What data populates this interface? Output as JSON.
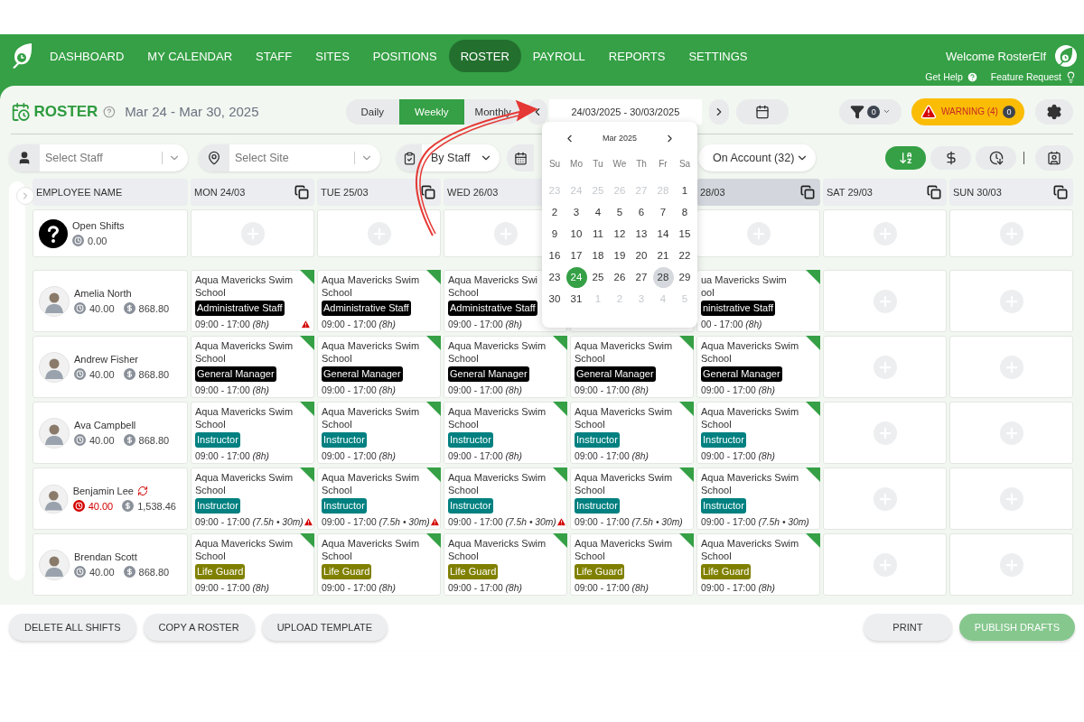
{
  "nav": {
    "items": [
      {
        "label": "DASHBOARD",
        "selected": false
      },
      {
        "label": "MY CALENDAR",
        "selected": false
      },
      {
        "label": "STAFF",
        "selected": false
      },
      {
        "label": "SITES",
        "selected": false
      },
      {
        "label": "POSITIONS",
        "selected": false
      },
      {
        "label": "ROSTER",
        "selected": true
      },
      {
        "label": "PAYROLL",
        "selected": false
      },
      {
        "label": "REPORTS",
        "selected": false
      },
      {
        "label": "SETTINGS",
        "selected": false
      }
    ],
    "welcome": "Welcome RosterElf",
    "links": [
      "Get Help",
      "Feature Request"
    ]
  },
  "header": {
    "title": "ROSTER",
    "date_range": "Mar 24 - Mar 30, 2025",
    "view_tabs": [
      {
        "label": "Daily",
        "selected": false
      },
      {
        "label": "Weekly",
        "selected": true
      },
      {
        "label": "Monthly",
        "selected": false
      }
    ],
    "date_field": "24/03/2025 - 30/03/2025",
    "filter_count": "0",
    "warning": {
      "label": "WARNING (4)",
      "count": "0"
    }
  },
  "filters": {
    "staff_placeholder": "Select Staff",
    "site_placeholder": "Select Site",
    "group_by": "By Staff",
    "account": "On Account (32)",
    "sort_buttons": [
      {
        "kind": "az",
        "selected": true
      },
      {
        "kind": "pay",
        "selected": false
      },
      {
        "kind": "time",
        "selected": false
      }
    ]
  },
  "datepicker": {
    "month": "Mar 2025",
    "weekdays": [
      "Su",
      "Mo",
      "Tu",
      "We",
      "Th",
      "Fr",
      "Sa"
    ],
    "days": [
      {
        "label": "23",
        "outside": true,
        "selected": false,
        "today": false
      },
      {
        "label": "24",
        "outside": true,
        "selected": false,
        "today": false
      },
      {
        "label": "25",
        "outside": true,
        "selected": false,
        "today": false
      },
      {
        "label": "26",
        "outside": true,
        "selected": false,
        "today": false
      },
      {
        "label": "27",
        "outside": true,
        "selected": false,
        "today": false
      },
      {
        "label": "28",
        "outside": true,
        "selected": false,
        "today": false
      },
      {
        "label": "1",
        "outside": false,
        "selected": false,
        "today": false
      },
      {
        "label": "2",
        "outside": false,
        "selected": false,
        "today": false
      },
      {
        "label": "3",
        "outside": false,
        "selected": false,
        "today": false
      },
      {
        "label": "4",
        "outside": false,
        "selected": false,
        "today": false
      },
      {
        "label": "5",
        "outside": false,
        "selected": false,
        "today": false
      },
      {
        "label": "6",
        "outside": false,
        "selected": false,
        "today": false
      },
      {
        "label": "7",
        "outside": false,
        "selected": false,
        "today": false
      },
      {
        "label": "8",
        "outside": false,
        "selected": false,
        "today": false
      },
      {
        "label": "9",
        "outside": false,
        "selected": false,
        "today": false
      },
      {
        "label": "10",
        "outside": false,
        "selected": false,
        "today": false
      },
      {
        "label": "11",
        "outside": false,
        "selected": false,
        "today": false
      },
      {
        "label": "12",
        "outside": false,
        "selected": false,
        "today": false
      },
      {
        "label": "13",
        "outside": false,
        "selected": false,
        "today": false
      },
      {
        "label": "14",
        "outside": false,
        "selected": false,
        "today": false
      },
      {
        "label": "15",
        "outside": false,
        "selected": false,
        "today": false
      },
      {
        "label": "16",
        "outside": false,
        "selected": false,
        "today": false
      },
      {
        "label": "17",
        "outside": false,
        "selected": false,
        "today": false
      },
      {
        "label": "18",
        "outside": false,
        "selected": false,
        "today": false
      },
      {
        "label": "19",
        "outside": false,
        "selected": false,
        "today": false
      },
      {
        "label": "20",
        "outside": false,
        "selected": false,
        "today": false
      },
      {
        "label": "21",
        "outside": false,
        "selected": false,
        "today": false
      },
      {
        "label": "22",
        "outside": false,
        "selected": false,
        "today": false
      },
      {
        "label": "23",
        "outside": false,
        "selected": false,
        "today": false
      },
      {
        "label": "24",
        "outside": false,
        "selected": true,
        "today": false
      },
      {
        "label": "25",
        "outside": false,
        "selected": false,
        "today": false
      },
      {
        "label": "26",
        "outside": false,
        "selected": false,
        "today": false
      },
      {
        "label": "27",
        "outside": false,
        "selected": false,
        "today": false
      },
      {
        "label": "28",
        "outside": false,
        "selected": false,
        "today": true
      },
      {
        "label": "29",
        "outside": false,
        "selected": false,
        "today": false
      },
      {
        "label": "30",
        "outside": false,
        "selected": false,
        "today": false
      },
      {
        "label": "31",
        "outside": false,
        "selected": false,
        "today": false
      },
      {
        "label": "1",
        "outside": true,
        "selected": false,
        "today": false
      },
      {
        "label": "2",
        "outside": true,
        "selected": false,
        "today": false
      },
      {
        "label": "3",
        "outside": true,
        "selected": false,
        "today": false
      },
      {
        "label": "4",
        "outside": true,
        "selected": false,
        "today": false
      },
      {
        "label": "5",
        "outside": true,
        "selected": false,
        "today": false
      }
    ]
  },
  "table": {
    "name_column": "EMPLOYEE NAME",
    "columns": [
      {
        "kind": "day",
        "label": "MON 24/03",
        "highlighted": false,
        "copy": true
      },
      {
        "kind": "day",
        "label": "TUE 25/03",
        "highlighted": false,
        "copy": true
      },
      {
        "kind": "day",
        "label": "WED 26/03",
        "highlighted": false,
        "copy": false
      },
      {
        "kind": "covered"
      },
      {
        "kind": "day",
        "label": "28/03",
        "highlighted": true,
        "copy": true
      },
      {
        "kind": "day",
        "label": "SAT 29/03",
        "highlighted": false,
        "copy": true
      },
      {
        "kind": "day",
        "label": "SUN 30/03",
        "highlighted": false,
        "copy": true
      }
    ],
    "rows": [
      {
        "kind": "open",
        "name": "Open Shifts",
        "hours": "0.00",
        "cells": [
          {
            "kind": "empty"
          },
          {
            "kind": "empty"
          },
          {
            "kind": "empty"
          },
          {
            "kind": "covered"
          },
          {
            "kind": "empty"
          },
          {
            "kind": "empty"
          },
          {
            "kind": "empty"
          }
        ]
      },
      {
        "kind": "staff",
        "name": "Amelia North",
        "hours": "40.00",
        "pay": "868.80",
        "over_hours": false,
        "sync": false,
        "cells": [
          {
            "kind": "shift",
            "site": [
              "Aqua Mavericks Swim",
              "School"
            ],
            "role": "Administrative Staff",
            "color": "#000000",
            "time": "09:00 - 17:00 *(8h)*",
            "flagged": true,
            "warning": true
          },
          {
            "kind": "shift",
            "site": [
              "Aqua Mavericks Swim",
              "School"
            ],
            "role": "Administrative Staff",
            "color": "#000000",
            "time": "09:00 - 17:00 *(8h)*",
            "flagged": true,
            "warning": false
          },
          {
            "kind": "shift",
            "site": [
              "Aqua Mavericks Swi",
              "School"
            ],
            "role": "Administrative Staff",
            "color": "#000000",
            "time": "09:00 - 17:00 *(8h)*",
            "flagged": false,
            "warning": false
          },
          {
            "kind": "covered"
          },
          {
            "kind": "shift",
            "site": [
              "ua Mavericks Swim",
              "ool"
            ],
            "role": "ninistrative Staff",
            "color": "#000000",
            "time": "00 - 17:00 *(8h)*",
            "flagged": true,
            "warning": false
          },
          {
            "kind": "empty"
          },
          {
            "kind": "empty"
          }
        ]
      },
      {
        "kind": "staff",
        "name": "Andrew Fisher",
        "hours": "40.00",
        "pay": "868.80",
        "over_hours": false,
        "sync": false,
        "cells": [
          {
            "kind": "shift",
            "site": [
              "Aqua Mavericks Swim",
              "School"
            ],
            "role": "General Manager",
            "color": "#000000",
            "time": "09:00 - 17:00 *(8h)*",
            "flagged": true,
            "warning": false
          },
          {
            "kind": "shift",
            "site": [
              "Aqua Mavericks Swim",
              "School"
            ],
            "role": "General Manager",
            "color": "#000000",
            "time": "09:00 - 17:00 *(8h)*",
            "flagged": true,
            "warning": false
          },
          {
            "kind": "shift",
            "site": [
              "Aqua Mavericks Swim",
              "School"
            ],
            "role": "General Manager",
            "color": "#000000",
            "time": "09:00 - 17:00 *(8h)*",
            "flagged": true,
            "warning": false
          },
          {
            "kind": "shift",
            "site": [
              "Aqua Mavericks Swim",
              "School"
            ],
            "role": "General Manager",
            "color": "#000000",
            "time": "09:00 - 17:00 *(8h)*",
            "flagged": true,
            "warning": false
          },
          {
            "kind": "shift",
            "site": [
              "Aqua Mavericks Swim",
              "School"
            ],
            "role": "General Manager",
            "color": "#000000",
            "time": "09:00 - 17:00 *(8h)*",
            "flagged": true,
            "warning": false
          },
          {
            "kind": "empty"
          },
          {
            "kind": "empty"
          }
        ]
      },
      {
        "kind": "staff",
        "name": "Ava Campbell",
        "hours": "40.00",
        "pay": "868.80",
        "over_hours": false,
        "sync": false,
        "cells": [
          {
            "kind": "shift",
            "site": [
              "Aqua Mavericks Swim",
              "School"
            ],
            "role": "Instructor",
            "color": "#008080",
            "time": "09:00 - 17:00 *(8h)*",
            "flagged": true,
            "warning": false
          },
          {
            "kind": "shift",
            "site": [
              "Aqua Mavericks Swim",
              "School"
            ],
            "role": "Instructor",
            "color": "#008080",
            "time": "09:00 - 17:00 *(8h)*",
            "flagged": true,
            "warning": false
          },
          {
            "kind": "shift",
            "site": [
              "Aqua Mavericks Swim",
              "School"
            ],
            "role": "Instructor",
            "color": "#008080",
            "time": "09:00 - 17:00 *(8h)*",
            "flagged": true,
            "warning": false
          },
          {
            "kind": "shift",
            "site": [
              "Aqua Mavericks Swim",
              "School"
            ],
            "role": "Instructor",
            "color": "#008080",
            "time": "09:00 - 17:00 *(8h)*",
            "flagged": true,
            "warning": false
          },
          {
            "kind": "shift",
            "site": [
              "Aqua Mavericks Swim",
              "School"
            ],
            "role": "Instructor",
            "color": "#008080",
            "time": "09:00 - 17:00 *(8h)*",
            "flagged": true,
            "warning": false
          },
          {
            "kind": "empty"
          },
          {
            "kind": "empty"
          }
        ]
      },
      {
        "kind": "staff",
        "name": "Benjamin Lee",
        "hours": "40.00",
        "pay": "1,538.46",
        "over_hours": true,
        "sync": true,
        "cells": [
          {
            "kind": "shift",
            "site": [
              "Aqua Mavericks Swim",
              "School"
            ],
            "role": "Instructor",
            "color": "#008080",
            "time": "09:00 - 17:00 *(7.5h • 30m)*",
            "flagged": true,
            "warning": true
          },
          {
            "kind": "shift",
            "site": [
              "Aqua Mavericks Swim",
              "School"
            ],
            "role": "Instructor",
            "color": "#008080",
            "time": "09:00 - 17:00 *(7.5h • 30m)*",
            "flagged": true,
            "warning": true
          },
          {
            "kind": "shift",
            "site": [
              "Aqua Mavericks Swim",
              "School"
            ],
            "role": "Instructor",
            "color": "#008080",
            "time": "09:00 - 17:00 *(7.5h • 30m)*",
            "flagged": true,
            "warning": true
          },
          {
            "kind": "shift",
            "site": [
              "Aqua Mavericks Swim",
              "School"
            ],
            "role": "Instructor",
            "color": "#008080",
            "time": "09:00 - 17:00 *(7.5h • 30m)*",
            "flagged": true,
            "warning": false
          },
          {
            "kind": "shift",
            "site": [
              "Aqua Mavericks Swim",
              "School"
            ],
            "role": "Instructor",
            "color": "#008080",
            "time": "09:00 - 17:00 *(7.5h • 30m)*",
            "flagged": true,
            "warning": false
          },
          {
            "kind": "empty"
          },
          {
            "kind": "empty"
          }
        ]
      },
      {
        "kind": "staff",
        "name": "Brendan Scott",
        "hours": "40.00",
        "pay": "868.80",
        "over_hours": false,
        "sync": false,
        "cells": [
          {
            "kind": "shift",
            "site": [
              "Aqua Mavericks Swim",
              "School"
            ],
            "role": "Life Guard",
            "color": "#808000",
            "time": "09:00 - 17:00 *(8h)*",
            "flagged": true,
            "warning": false
          },
          {
            "kind": "shift",
            "site": [
              "Aqua Mavericks Swim",
              "School"
            ],
            "role": "Life Guard",
            "color": "#808000",
            "time": "09:00 - 17:00 *(8h)*",
            "flagged": true,
            "warning": false
          },
          {
            "kind": "shift",
            "site": [
              "Aqua Mavericks Swim",
              "School"
            ],
            "role": "Life Guard",
            "color": "#808000",
            "time": "09:00 - 17:00 *(8h)*",
            "flagged": true,
            "warning": false
          },
          {
            "kind": "shift",
            "site": [
              "Aqua Mavericks Swim",
              "School"
            ],
            "role": "Life Guard",
            "color": "#808000",
            "time": "09:00 - 17:00 *(8h)*",
            "flagged": true,
            "warning": false
          },
          {
            "kind": "shift",
            "site": [
              "Aqua Mavericks Swim",
              "School"
            ],
            "role": "Life Guard",
            "color": "#808000",
            "time": "09:00 - 17:00 *(8h)*",
            "flagged": true,
            "warning": false
          },
          {
            "kind": "empty"
          },
          {
            "kind": "empty"
          }
        ]
      }
    ]
  },
  "footer": {
    "left_buttons": [
      "DELETE ALL SHIFTS",
      "COPY A ROSTER",
      "UPLOAD TEMPLATE"
    ],
    "right_buttons": [
      {
        "label": "PRINT",
        "kind": "plain"
      },
      {
        "label": "PUBLISH DRAFTS",
        "kind": "primary"
      }
    ]
  }
}
